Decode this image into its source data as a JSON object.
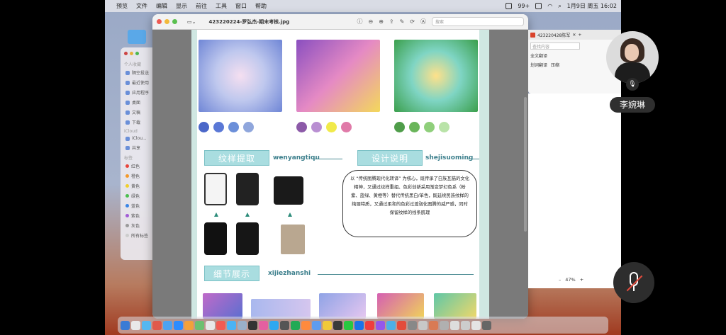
{
  "menubar": {
    "apple": "",
    "items": [
      "预览",
      "文件",
      "编辑",
      "显示",
      "前往",
      "工具",
      "窗口",
      "帮助"
    ],
    "status": "99+",
    "datetime": "1月9日 周五 16:02"
  },
  "finder": {
    "favorites_header": "个人收藏",
    "favorites": [
      "隔空投送",
      "最近使用",
      "应用程序",
      "桌面",
      "文稿",
      "下载"
    ],
    "icloud_header": "iCloud",
    "icloud": [
      "iClou...",
      "共享"
    ],
    "tags_header": "标签",
    "tags": [
      {
        "label": "红色",
        "color": "#e8453c"
      },
      {
        "label": "橙色",
        "color": "#f39a2b"
      },
      {
        "label": "黄色",
        "color": "#f1cf2c"
      },
      {
        "label": "绿色",
        "color": "#4cbf4f"
      },
      {
        "label": "蓝色",
        "color": "#3a85e6"
      },
      {
        "label": "紫色",
        "color": "#a25cd6"
      },
      {
        "label": "灰色",
        "color": "#9a9a9a"
      },
      {
        "label": "所有标签",
        "color": "#cccccc"
      }
    ]
  },
  "preview": {
    "title": "423220224-罗弘杰-期末考核.jpg",
    "search_placeholder": "搜索"
  },
  "poster": {
    "palettes": [
      [
        "#4a67c9",
        "#5a78d6",
        "#6b8fd9",
        "#8fa6dc"
      ],
      [
        "#8c5aa8",
        "#b98fd2",
        "#f1ea4a",
        "#e07aa8"
      ],
      [
        "#4f9d4a",
        "#6ab55a",
        "#8fcf7b",
        "#b9e3a8"
      ]
    ],
    "section1_title": "纹样提取",
    "section1_pinyin": "wenyangtiqu",
    "section2_title": "设计说明",
    "section2_pinyin": "shejisuoming",
    "section3_title": "细节展示",
    "section3_pinyin": "xijiezhanshi",
    "description": "以 “传统图腾现代化转译” 为核心，既传承了白族瓦猫的文化精神，又通过纹样重组、色彩创新采用渐变梦幻色系（粉紫、蓝绿、黄橙等）替代传统黑白/单色，既延续民族纹样的绚丽特质，又通过柔和的色彩过渡弱化图腾的威严感，同时保留纹样的线条肌理"
  },
  "word": {
    "tab_title": "423220428陈军",
    "search_placeholder": "查找内容",
    "btn_fulltext": "全文翻译",
    "btn_word": "划词翻译",
    "btn_compress": "压缩",
    "zoom": "47%"
  },
  "presenter": {
    "name": "李婉琳"
  }
}
